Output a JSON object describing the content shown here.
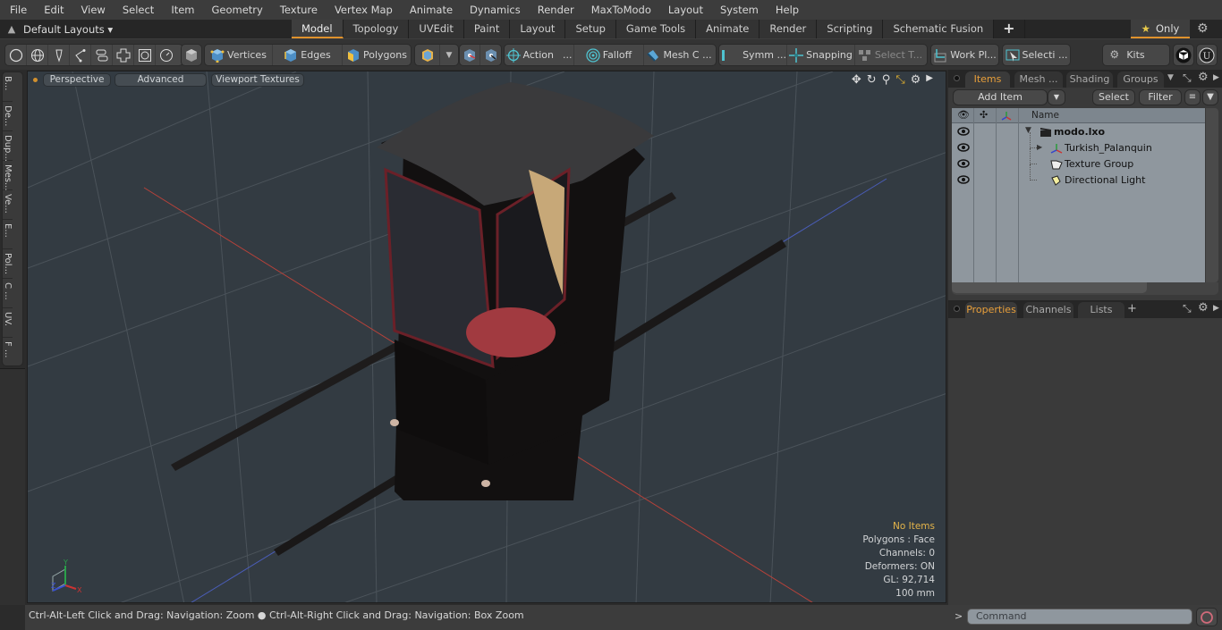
{
  "menu": [
    "File",
    "Edit",
    "View",
    "Select",
    "Item",
    "Geometry",
    "Texture",
    "Vertex Map",
    "Animate",
    "Dynamics",
    "Render",
    "MaxToModo",
    "Layout",
    "System",
    "Help"
  ],
  "layout_bar": {
    "layouts_label": "Default Layouts ▾",
    "tabs": [
      {
        "label": "Model",
        "active": true
      },
      {
        "label": "Topology",
        "active": false
      },
      {
        "label": "UVEdit",
        "active": false
      },
      {
        "label": "Paint",
        "active": false
      },
      {
        "label": "Layout",
        "active": false
      },
      {
        "label": "Setup",
        "active": false
      },
      {
        "label": "Game Tools",
        "active": false
      },
      {
        "label": "Animate",
        "active": false
      },
      {
        "label": "Render",
        "active": false
      },
      {
        "label": "Scripting",
        "active": false
      },
      {
        "label": "Schematic Fusion",
        "active": false
      }
    ],
    "add_tab": "+",
    "only_label": "Only"
  },
  "toolbar": {
    "vertices": "Vertices",
    "edges": "Edges",
    "polygons": "Polygons",
    "action": "Action",
    "falloff": "Falloff",
    "mesh_c": "Mesh C ...",
    "symm": "Symm ...",
    "snapping": "Snapping",
    "select_t": "Select T...",
    "work_pl": "Work Pl...",
    "selecti": "Selecti ...",
    "kits": "Kits",
    "ellipsis": "..."
  },
  "left_tabs": [
    "B...",
    "De...",
    "Dup...",
    "Mes...",
    "Ve...",
    "E...",
    "Pol...",
    "C ...",
    "UV.",
    "F ..."
  ],
  "viewport": {
    "buttons": [
      "Perspective",
      "Advanced",
      "Viewport Textures"
    ],
    "info": {
      "selection": "No Items",
      "polygons": "Polygons : Face",
      "channels": "Channels: 0",
      "deformers": "Deformers: ON",
      "gl": "GL: 92,714",
      "unit": "100 mm"
    },
    "axis": {
      "x": "X",
      "y": "Y",
      "z": "Z"
    }
  },
  "status": "Ctrl-Alt-Left Click and Drag: Navigation: Zoom ● Ctrl-Alt-Right Click and Drag: Navigation: Box Zoom",
  "items_panel": {
    "tabs": [
      {
        "label": "Items",
        "active": true
      },
      {
        "label": "Mesh ...",
        "active": false
      },
      {
        "label": "Shading",
        "active": false
      },
      {
        "label": "Groups",
        "active": false
      }
    ],
    "add_item": "Add Item",
    "select": "Select",
    "filter": "Filter",
    "column_name": "Name",
    "tree": [
      {
        "label": "modo.lxo",
        "icon": "scene-icon",
        "level": 0,
        "expanded": true,
        "bold": true
      },
      {
        "label": "Turkish_Palanquin",
        "icon": "locator-icon",
        "level": 1,
        "collapsed": true
      },
      {
        "label": "Texture Group",
        "icon": "texture-group-icon",
        "level": 1
      },
      {
        "label": "Directional Light",
        "icon": "light-icon",
        "level": 1
      }
    ]
  },
  "properties_panel": {
    "tabs": [
      {
        "label": "Properties",
        "active": true
      },
      {
        "label": "Channels",
        "active": false
      },
      {
        "label": "Lists",
        "active": false
      }
    ],
    "add_tab": "+"
  },
  "command": {
    "prompt": ">",
    "placeholder": "Command"
  },
  "colors": {
    "accent": "#e0922c",
    "viewport_bg": "#333b42",
    "tree_bg": "#8f979e"
  }
}
